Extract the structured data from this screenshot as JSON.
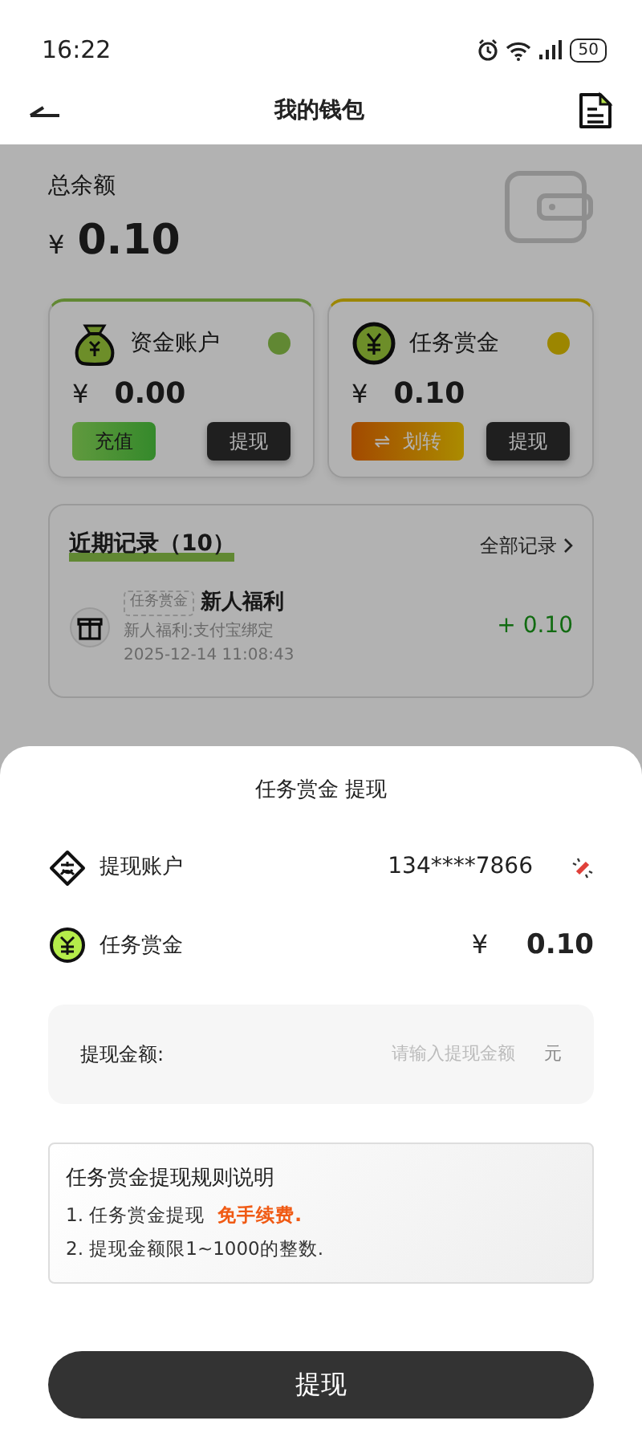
{
  "status_bar": {
    "time": "16:22",
    "battery": "50"
  },
  "header": {
    "title": "我的钱包"
  },
  "balance": {
    "label": "总余额",
    "currency": "¥",
    "amount": "0.10"
  },
  "accounts": [
    {
      "kind": "fund",
      "name": "资金账户",
      "currency": "¥",
      "amount": "0.00",
      "buttons": [
        {
          "kind": "green",
          "label": "充值"
        },
        {
          "kind": "dark",
          "label": "提现"
        }
      ]
    },
    {
      "kind": "reward",
      "name": "任务赏金",
      "currency": "¥",
      "amount": "0.10",
      "buttons": [
        {
          "kind": "orange",
          "icon": "⇌",
          "label": "划转"
        },
        {
          "kind": "dark",
          "label": "提现"
        }
      ]
    }
  ],
  "records": {
    "title": "近期记录（10）",
    "all_link": "全部记录",
    "items": [
      {
        "tag": "任务赏金",
        "title": "新人福利",
        "desc": "新人福利:支付宝绑定",
        "time": "2025-12-14 11:08:43",
        "amount": "+ 0.10"
      }
    ]
  },
  "sheet": {
    "title": "任务赏金 提现",
    "rows": [
      {
        "kind": "account",
        "label": "提现账户",
        "value": "134****7866"
      },
      {
        "kind": "balance",
        "label": "任务赏金",
        "currency": "¥",
        "value": "0.10"
      }
    ],
    "amount_field": {
      "label": "提现金额:",
      "placeholder": "请输入提现金额",
      "unit": "元"
    },
    "rules": {
      "title": "任务赏金提现规则说明",
      "items": [
        {
          "text": "1. 任务赏金提现",
          "note": "免手续费."
        },
        {
          "text": "2. 提现金额限1~1000的整数."
        }
      ]
    },
    "submit": "提现"
  }
}
